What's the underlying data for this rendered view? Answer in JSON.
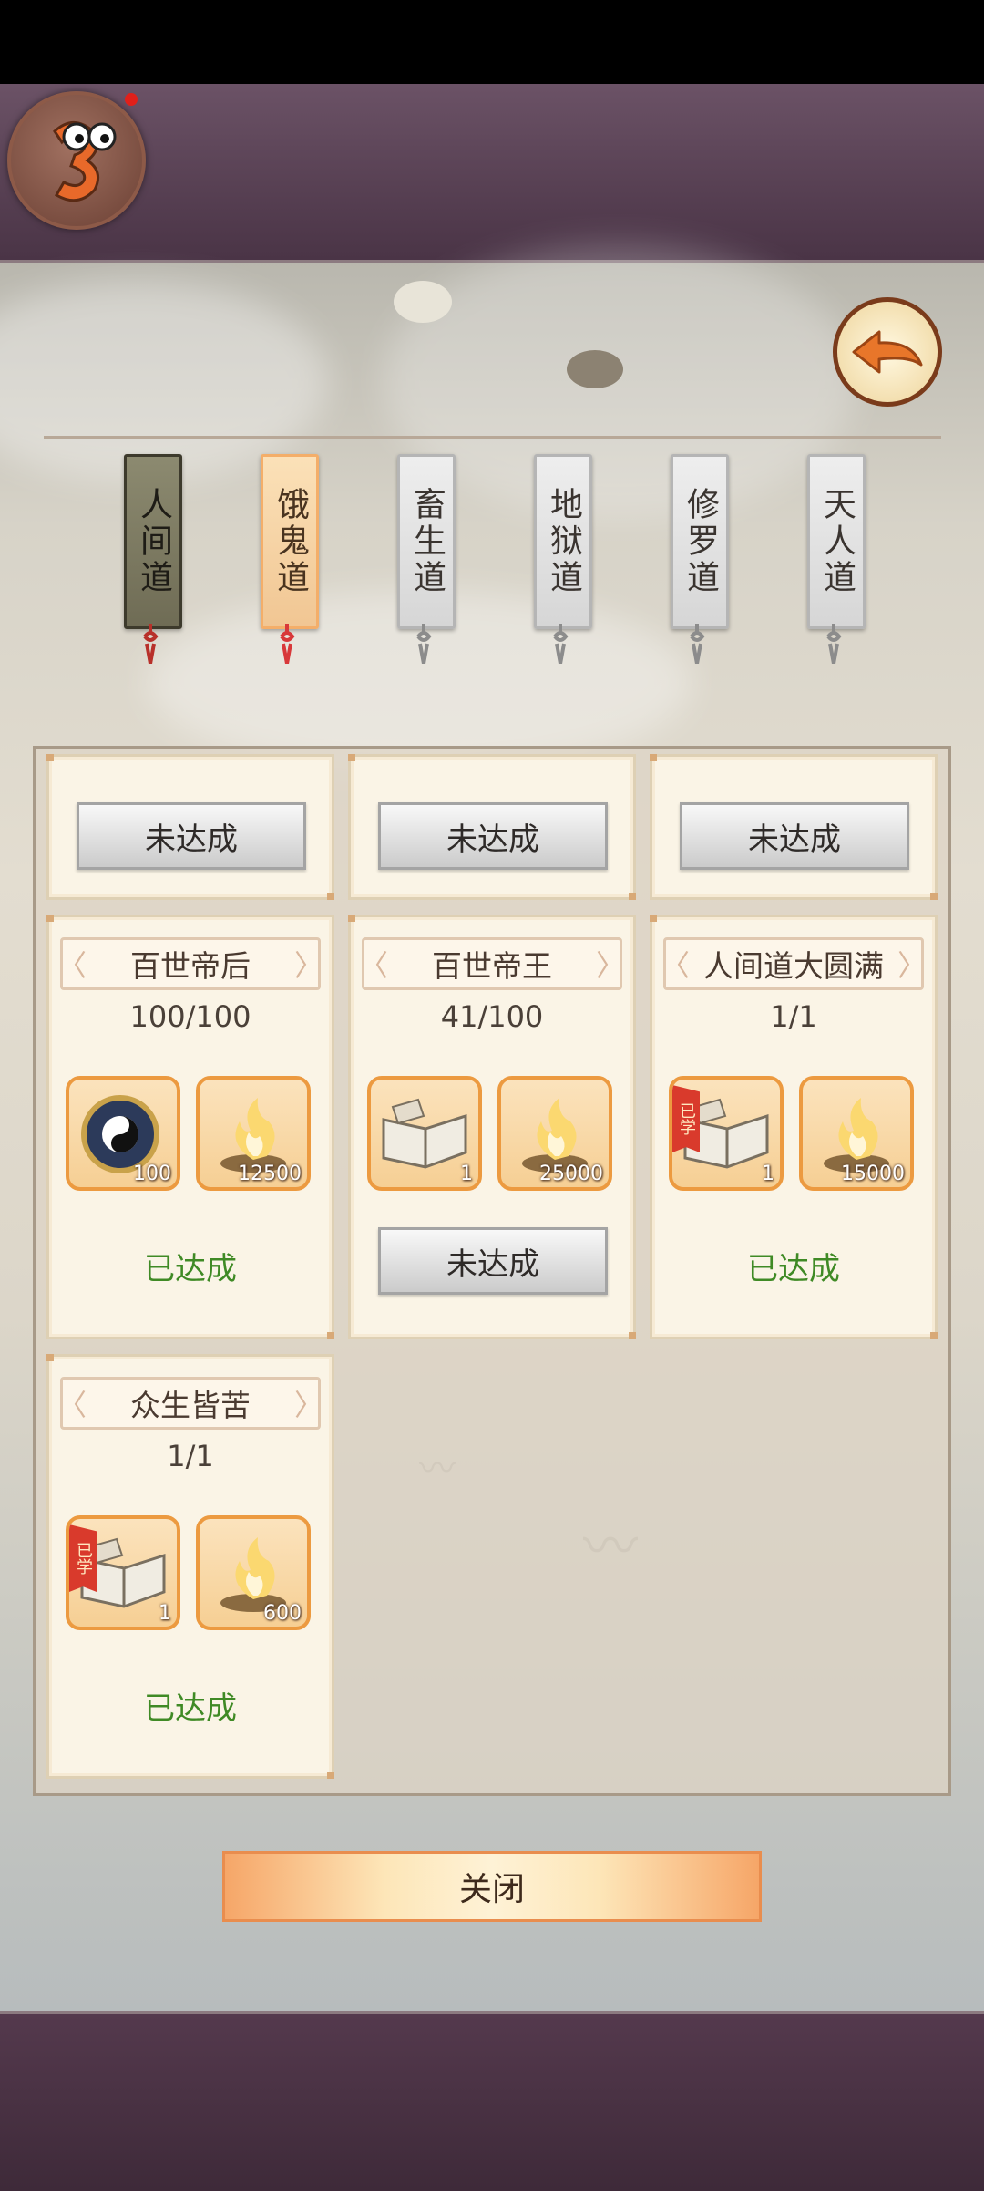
{
  "colors": {
    "accent_orange": "#ec9a40",
    "achieved_green": "#3f8a25",
    "frame_purple": "#4a3446"
  },
  "tabs": [
    {
      "label": "人间道",
      "state": "active"
    },
    {
      "label": "饿鬼道",
      "state": "selected"
    },
    {
      "label": "畜生道",
      "state": "normal"
    },
    {
      "label": "地狱道",
      "state": "normal"
    },
    {
      "label": "修罗道",
      "state": "normal"
    },
    {
      "label": "天人道",
      "state": "normal"
    }
  ],
  "top_row": {
    "labels": [
      "未达成",
      "未达成",
      "未达成"
    ]
  },
  "cards": [
    {
      "title": "百世帝后",
      "progress": "100/100",
      "rewards": [
        {
          "icon": "taiji-compass-icon",
          "count": "100"
        },
        {
          "icon": "spirit-flame-icon",
          "count": "12500"
        }
      ],
      "status": "已达成"
    },
    {
      "title": "百世帝王",
      "progress": "41/100",
      "rewards": [
        {
          "icon": "scroll-book-icon",
          "count": "1"
        },
        {
          "icon": "spirit-flame-icon",
          "count": "25000"
        }
      ],
      "status": "未达成"
    },
    {
      "title": "人间道大圆满",
      "progress": "1/1",
      "rewards": [
        {
          "icon": "scroll-book-icon",
          "count": "1",
          "badge": "已学"
        },
        {
          "icon": "spirit-flame-icon",
          "count": "15000"
        }
      ],
      "status": "已达成"
    },
    {
      "title": "众生皆苦",
      "progress": "1/1",
      "rewards": [
        {
          "icon": "scroll-book-icon",
          "count": "1",
          "badge": "已学"
        },
        {
          "icon": "spirit-flame-icon",
          "count": "600"
        }
      ],
      "status": "已达成"
    }
  ],
  "close_label": "关闭"
}
